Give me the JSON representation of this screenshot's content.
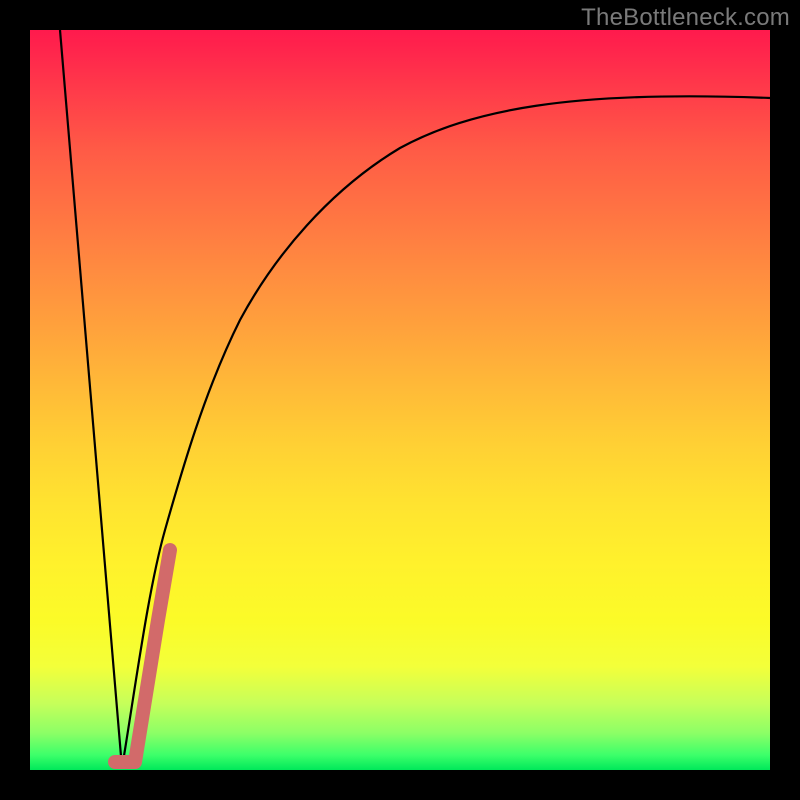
{
  "watermark": {
    "text": "TheBottleneck.com"
  },
  "colors": {
    "frame": "#000000",
    "curve": "#000000",
    "highlight": "#d26a6a",
    "gradient_top": "#ff1a4d",
    "gradient_bottom": "#00e85a"
  },
  "chart_data": {
    "type": "line",
    "title": "",
    "xlabel": "",
    "ylabel": "",
    "xlim": [
      0,
      100
    ],
    "ylim": [
      0,
      100
    ],
    "grid": false,
    "legend": false,
    "series": [
      {
        "name": "left-descent",
        "x": [
          4,
          12.5
        ],
        "y": [
          100,
          0
        ],
        "stroke": "#000000"
      },
      {
        "name": "right-log-curve",
        "x": [
          12.5,
          14,
          16,
          18,
          20,
          23,
          26,
          30,
          35,
          40,
          46,
          54,
          64,
          76,
          88,
          100
        ],
        "y": [
          0,
          10,
          22,
          32,
          40,
          49,
          56,
          63,
          69,
          74,
          78,
          82,
          85.5,
          88,
          89.5,
          90.5
        ],
        "stroke": "#000000"
      },
      {
        "name": "highlight-segment",
        "x": [
          12,
          13.5,
          17,
          19
        ],
        "y": [
          1,
          1,
          20,
          30
        ],
        "stroke": "#d26a6a",
        "width": 14
      }
    ]
  }
}
